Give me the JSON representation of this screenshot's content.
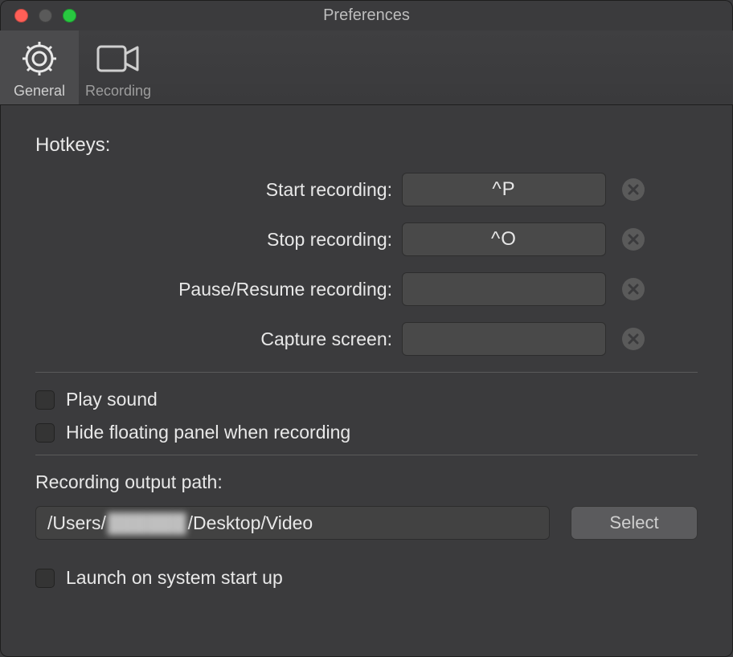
{
  "window": {
    "title": "Preferences"
  },
  "tabs": {
    "general": "General",
    "recording": "Recording"
  },
  "hotkeys": {
    "title": "Hotkeys:",
    "items": [
      {
        "label": "Start recording:",
        "value": "^P"
      },
      {
        "label": "Stop recording:",
        "value": "^O"
      },
      {
        "label": "Pause/Resume recording:",
        "value": ""
      },
      {
        "label": "Capture screen:",
        "value": ""
      }
    ]
  },
  "options": {
    "play_sound": "Play sound",
    "hide_panel": "Hide floating panel when recording",
    "launch_startup": "Launch on system start up"
  },
  "output": {
    "label": "Recording output path:",
    "path_prefix": "/Users/",
    "path_redacted": "██████",
    "path_suffix": "/Desktop/Video",
    "select": "Select"
  }
}
